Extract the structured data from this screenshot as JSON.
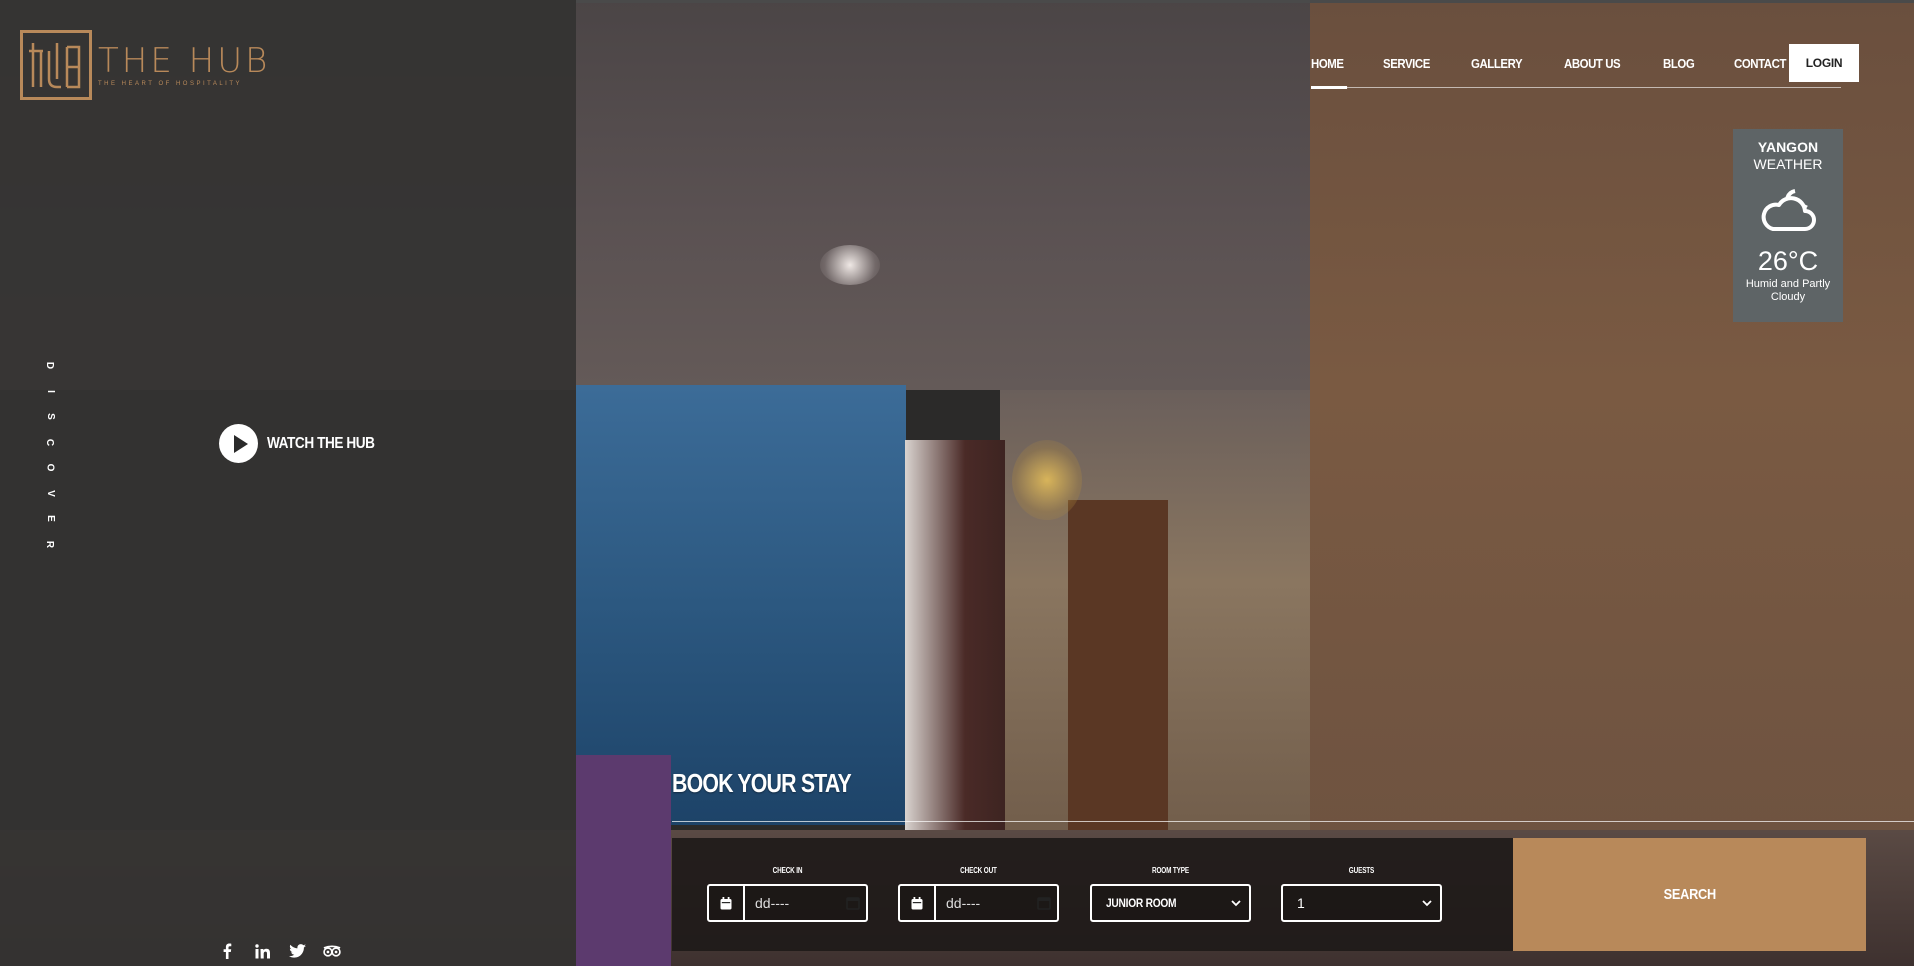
{
  "brand": {
    "name": "THE HUB",
    "tagline": "THE HEART OF HOSPITALITY",
    "accent_color": "#b8895a"
  },
  "nav": {
    "items": [
      {
        "label": "HOME",
        "active": true
      },
      {
        "label": "SERVICE",
        "active": false
      },
      {
        "label": "GALLERY",
        "active": false
      },
      {
        "label": "ABOUT US",
        "active": false
      },
      {
        "label": "BLOG",
        "active": false
      },
      {
        "label": "CONTACT US",
        "active": false
      }
    ],
    "login_label": "LOGIN"
  },
  "side": {
    "discover_letters": [
      "D",
      "I",
      "S",
      "C",
      "O",
      "V",
      "E",
      "R"
    ],
    "watch_label": "WATCH THE HUB",
    "social_icons": [
      "facebook-icon",
      "linkedin-icon",
      "twitter-icon",
      "tripadvisor-icon"
    ]
  },
  "weather": {
    "city": "YANGON",
    "label": "WEATHER",
    "icon": "partly-cloudy-icon",
    "temperature": "26°C",
    "description": "Humid and Partly Cloudy"
  },
  "booking": {
    "title": "BOOK YOUR STAY",
    "check_in": {
      "label": "CHECK IN",
      "value": "dd----"
    },
    "check_out": {
      "label": "CHECK OUT",
      "value": "dd----"
    },
    "room_type": {
      "label": "ROOM TYPE",
      "selected": "JUNIOR ROOM"
    },
    "guests": {
      "label": "GUESTS",
      "selected": "1"
    },
    "search_label": "SEARCH"
  }
}
